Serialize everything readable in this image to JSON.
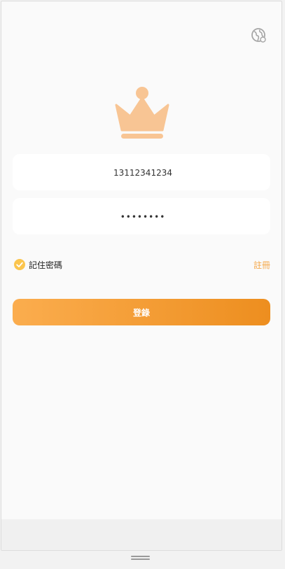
{
  "login_form": {
    "phone_value": "13112341234",
    "password_value": "qwerty12",
    "remember_label": "記住密碼",
    "remember_checked": true,
    "register_label": "註冊",
    "login_label": "登錄"
  },
  "icons": {
    "language": "globe-icon",
    "logo": "crown-icon",
    "remember": "check-icon"
  },
  "colors": {
    "accent": "#f5a84a",
    "button_gradient_start": "#fbad4e",
    "button_gradient_end": "#ed8e1f",
    "logo": "#f8c594",
    "check": "#fbc54e"
  }
}
